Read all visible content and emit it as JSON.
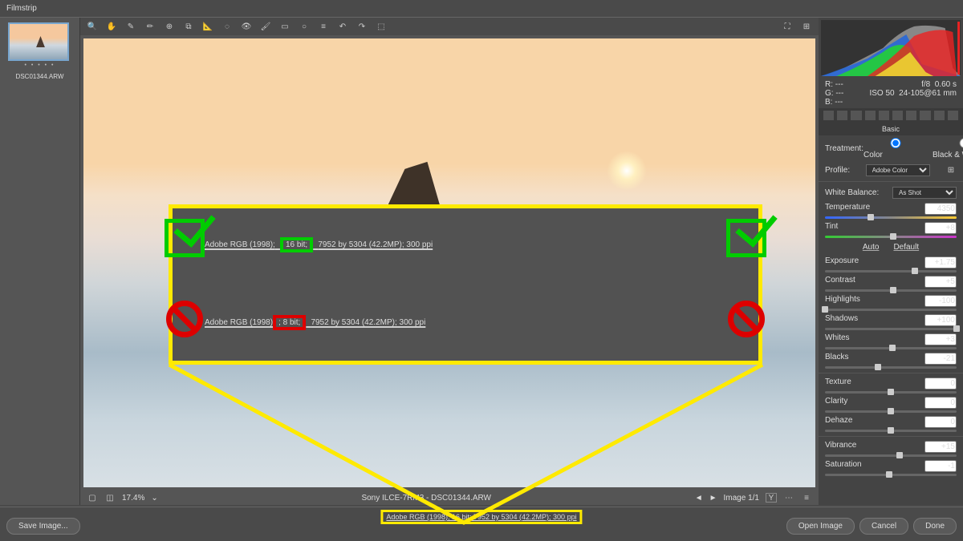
{
  "filmstrip": {
    "header": "Filmstrip",
    "thumb_name": "DSC01344.ARW"
  },
  "toolbar_icons": [
    "zoom",
    "hand",
    "eyedropper-white",
    "eyedropper-color",
    "target",
    "crop",
    "straighten",
    "spot",
    "eye",
    "brush",
    "gradient",
    "radial",
    "rotate-ccw",
    "rotate-cw",
    "mark"
  ],
  "viewer": {
    "zoom": "17.4%",
    "camera_file": "Sony ILCE-7RM3  -  DSC01344.ARW",
    "image_nav": "Image 1/1"
  },
  "callout": {
    "line1_pre": "Adobe RGB (1998);",
    "line1_bit": "16 bit;",
    "line1_post": "7952 by 5304 (42.2MP); 300 ppi",
    "line2_pre": "Adobe RGB (1998)",
    "line2_bit": "; 8 bit;",
    "line2_post": "7952 by 5304 (42.2MP); 300 ppi"
  },
  "workflow_link": "Adobe RGB (1998); 16 bit; 7952 by 5304 (42.2MP); 300 ppi",
  "buttons": {
    "save": "Save Image...",
    "open": "Open Image",
    "cancel": "Cancel",
    "done": "Done"
  },
  "info": {
    "r": "R:",
    "g": "G:",
    "b": "B:",
    "dash": "---",
    "aperture": "f/8",
    "shutter": "0.60 s",
    "iso": "ISO 50",
    "lens": "24-105@61 mm"
  },
  "basic": {
    "title": "Basic",
    "treatment": "Treatment:",
    "color": "Color",
    "bw": "Black & White",
    "profile": "Profile:",
    "profile_val": "Adobe Color",
    "wb": "White Balance:",
    "wb_val": "As Shot",
    "temp": "Temperature",
    "temp_val": "4350",
    "tint": "Tint",
    "tint_val": "+8",
    "auto": "Auto",
    "default": "Default",
    "exposure": "Exposure",
    "exposure_val": "+1.75",
    "contrast": "Contrast",
    "contrast_val": "+5",
    "highlights": "Highlights",
    "highlights_val": "-100",
    "shadows": "Shadows",
    "shadows_val": "+100",
    "whites": "Whites",
    "whites_val": "+3",
    "blacks": "Blacks",
    "blacks_val": "-21",
    "texture": "Texture",
    "texture_val": "0",
    "clarity": "Clarity",
    "clarity_val": "0",
    "dehaze": "Dehaze",
    "dehaze_val": "0",
    "vibrance": "Vibrance",
    "vibrance_val": "+15",
    "saturation": "Saturation",
    "saturation_val": "-1"
  }
}
